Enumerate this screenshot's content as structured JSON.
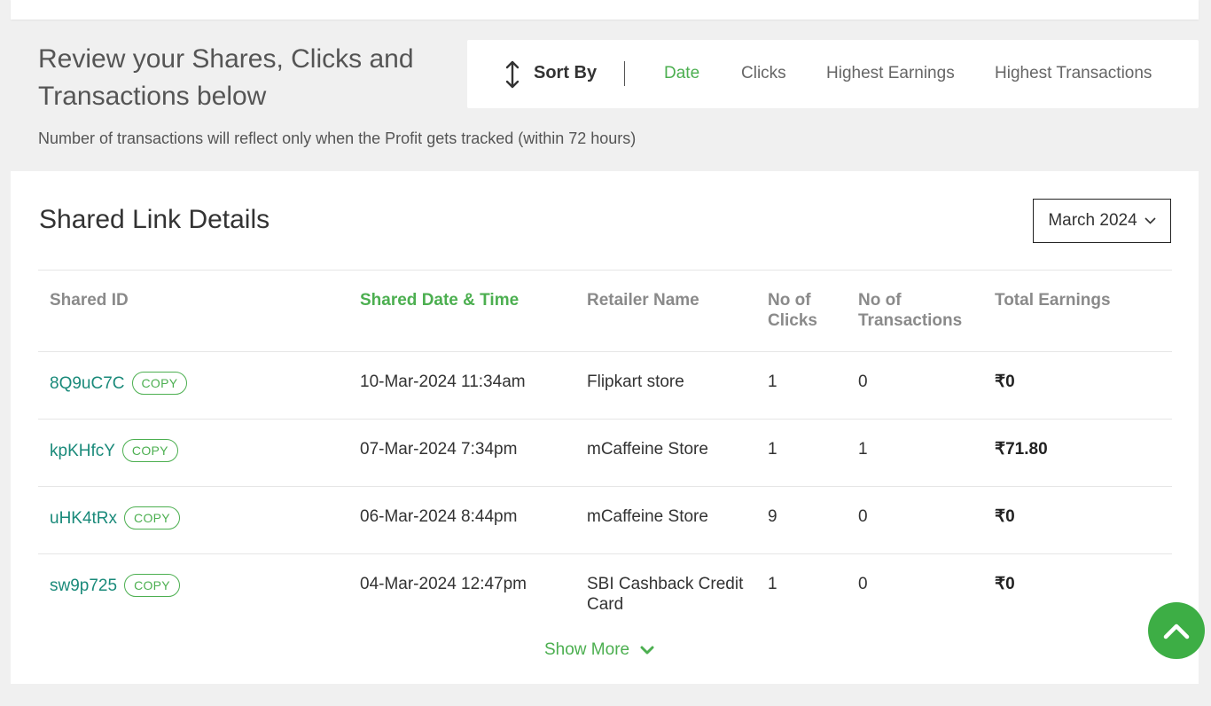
{
  "review": {
    "title": "Review your Shares, Clicks and Transactions below",
    "note": "Number of transactions will reflect only when the Profit gets tracked (within 72 hours)"
  },
  "sort": {
    "label": "Sort By",
    "icon": "sort-arrows-icon",
    "options": [
      "Date",
      "Clicks",
      "Highest Earnings",
      "Highest Transactions"
    ],
    "active": "Date"
  },
  "details": {
    "title": "Shared Link Details",
    "month": "March 2024",
    "columns": [
      "Shared ID",
      "Shared Date & Time",
      "Retailer Name",
      "No of Clicks",
      "No of Transactions",
      "Total Earnings"
    ],
    "copy_label": "COPY",
    "rows": [
      {
        "id": "8Q9uC7C",
        "date": "10-Mar-2024 11:34am",
        "retailer": "Flipkart store",
        "clicks": "1",
        "transactions": "0",
        "earnings": "₹0"
      },
      {
        "id": "kpKHfcY",
        "date": "07-Mar-2024 7:34pm",
        "retailer": "mCaffeine Store",
        "clicks": "1",
        "transactions": "1",
        "earnings": "₹71.80"
      },
      {
        "id": "uHK4tRx",
        "date": "06-Mar-2024 8:44pm",
        "retailer": "mCaffeine Store",
        "clicks": "9",
        "transactions": "0",
        "earnings": "₹0"
      },
      {
        "id": "sw9p725",
        "date": "04-Mar-2024 12:47pm",
        "retailer": "SBI Cashback Credit Card",
        "clicks": "1",
        "transactions": "0",
        "earnings": "₹0"
      }
    ],
    "show_more": "Show More"
  },
  "colors": {
    "accent": "#4caf50",
    "id_link": "#1a8a7a",
    "scroll_button": "#3dae45"
  }
}
